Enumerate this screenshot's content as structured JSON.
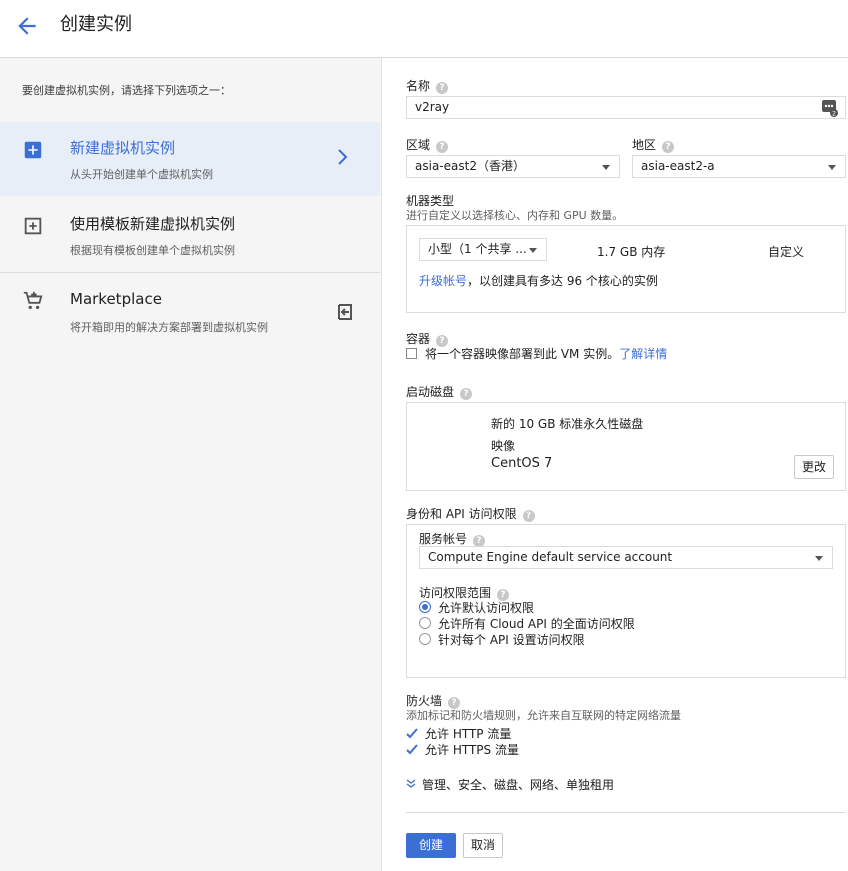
{
  "header": {
    "title": "创建实例"
  },
  "left": {
    "prompt": "要创建虚拟机实例，请选择下列选项之一：",
    "options": [
      {
        "title": "新建虚拟机实例",
        "subtitle": "从头开始创建单个虚拟机实例",
        "icon": "add-box-icon",
        "selected": true
      },
      {
        "title": "使用模板新建虚拟机实例",
        "subtitle": "根据现有模板创建单个虚拟机实例",
        "icon": "template-icon",
        "selected": false
      },
      {
        "title": "Marketplace",
        "subtitle": "将开箱即用的解决方案部署到虚拟机实例",
        "icon": "cart-icon",
        "selected": false
      }
    ]
  },
  "form": {
    "name": {
      "label": "名称",
      "value": "v2ray"
    },
    "region": {
      "label": "区域",
      "value": "asia-east2（香港）"
    },
    "zone": {
      "label": "地区",
      "value": "asia-east2-a"
    },
    "machine": {
      "label": "机器类型",
      "desc": "进行自定义以选择核心、内存和 GPU 数量。",
      "type_value": "小型（1 个共享 ...",
      "memory": "1.7 GB 内存",
      "customize": "自定义",
      "upgrade_link": "升级帐号",
      "upgrade_text": "，以创建具有多达 96 个核心的实例"
    },
    "container": {
      "label": "容器",
      "checkbox_label": "将一个容器映像部署到此 VM 实例。",
      "learn_more": "了解详情",
      "checked": false
    },
    "boot_disk": {
      "label": "启动磁盘",
      "desc": "新的 10 GB 标准永久性磁盘",
      "image_label": "映像",
      "image_value": "CentOS 7",
      "change_button": "更改"
    },
    "identity": {
      "label": "身份和 API 访问权限",
      "service_account_label": "服务帐号",
      "service_account_value": "Compute Engine default service account",
      "scope_label": "访问权限范围",
      "scopes": [
        {
          "label": "允许默认访问权限",
          "selected": true
        },
        {
          "label": "允许所有 Cloud API 的全面访问权限",
          "selected": false
        },
        {
          "label": "针对每个 API 设置访问权限",
          "selected": false
        }
      ]
    },
    "firewall": {
      "label": "防火墙",
      "desc": "添加标记和防火墙规则，允许来自互联网的特定网络流量",
      "http": "允许 HTTP 流量",
      "https": "允许 HTTPS 流量",
      "http_checked": true,
      "https_checked": true
    },
    "more": "管理、安全、磁盘、网络、单独租用",
    "create_button": "创建",
    "cancel_button": "取消"
  },
  "colors": {
    "accent": "#3b6fd4",
    "selected_bg": "#e8eef8",
    "sidebar_bg": "#f5f5f5"
  }
}
